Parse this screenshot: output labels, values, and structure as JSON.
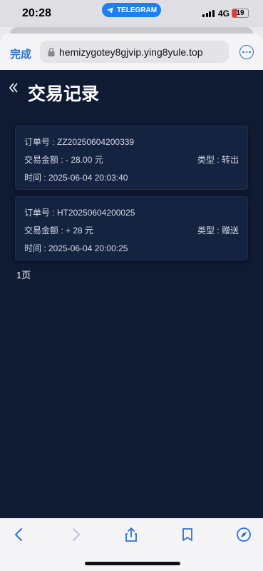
{
  "status": {
    "time": "20:28",
    "telegram_label": "TELEGRAM",
    "network": "4G",
    "battery": "19"
  },
  "browser": {
    "done_label": "完成",
    "url": "hemizygotey8gjvip.ying8yule.top",
    "accent": "#2f6fd6"
  },
  "page": {
    "title": "交易记录",
    "background": "#0f1a33",
    "pager": "1页"
  },
  "transactions": [
    {
      "order": "订单号 : ZZ20250604200339",
      "amount": "交易金额 : - 28.00 元",
      "type": "类型 : 转出",
      "time": "时间 : 2025-06-04 20:03:40"
    },
    {
      "order": "订单号 : HT20250604200025",
      "amount": "交易金额 : + 28 元",
      "type": "类型 : 赠送",
      "time": "时间 : 2025-06-04 20:00:25"
    }
  ],
  "toolbar": {
    "icons": [
      "back-arrow-icon",
      "forward-arrow-icon",
      "share-icon",
      "bookmarks-icon",
      "compass-icon"
    ]
  }
}
